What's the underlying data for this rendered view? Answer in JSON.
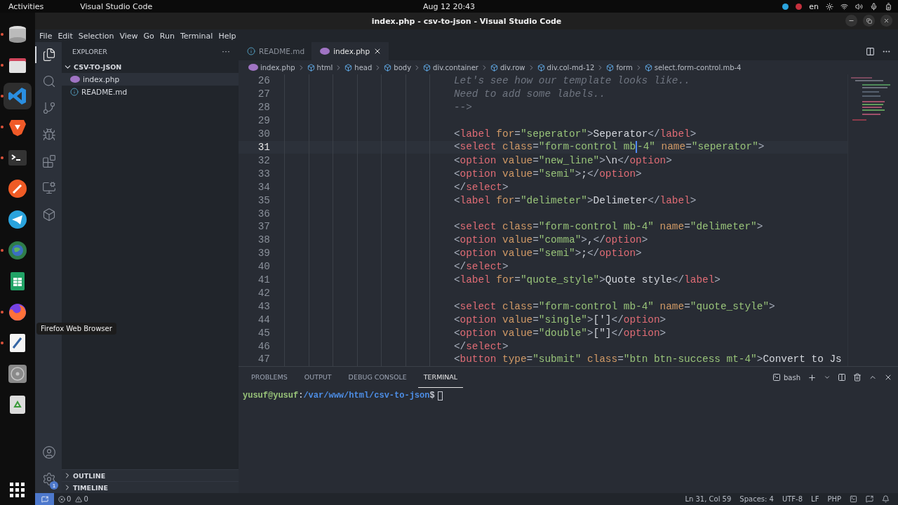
{
  "top_bar": {
    "activities": "Activities",
    "app_name": "Visual Studio Code",
    "clock": "Aug 12  20:43",
    "keyboard": "en"
  },
  "dock": {
    "items": [
      {
        "kind": "database",
        "running": true,
        "active": false
      },
      {
        "kind": "folder",
        "running": true,
        "active": false
      },
      {
        "kind": "vscode",
        "running": true,
        "active": true
      },
      {
        "kind": "brave",
        "running": true,
        "active": false
      },
      {
        "kind": "terminal",
        "running": true,
        "active": false
      },
      {
        "kind": "postman",
        "running": false,
        "active": false
      },
      {
        "kind": "telegram",
        "running": false,
        "active": false
      },
      {
        "kind": "globe",
        "running": true,
        "active": false
      },
      {
        "kind": "spreadsheet",
        "running": false,
        "active": false
      },
      {
        "kind": "firefox",
        "running": true,
        "active": false
      },
      {
        "kind": "editor",
        "running": true,
        "active": false
      },
      {
        "kind": "disc",
        "running": false,
        "active": false
      },
      {
        "kind": "trash",
        "running": false,
        "active": false
      }
    ],
    "tooltip": "Firefox Web Browser"
  },
  "window": {
    "title": "index.php - csv-to-json - Visual Studio Code"
  },
  "menu": [
    "File",
    "Edit",
    "Selection",
    "View",
    "Go",
    "Run",
    "Terminal",
    "Help"
  ],
  "activity_bar": [
    {
      "kind": "explorer",
      "selected": true
    },
    {
      "kind": "search",
      "selected": false
    },
    {
      "kind": "source-control",
      "selected": false
    },
    {
      "kind": "run",
      "selected": false
    },
    {
      "kind": "extensions",
      "selected": false
    },
    {
      "kind": "remote",
      "selected": false
    },
    {
      "kind": "docker",
      "selected": false
    }
  ],
  "settings_badge": "1",
  "sidebar": {
    "title": "EXPLORER",
    "more": "···",
    "folder": {
      "name": "CSV-TO-JSON",
      "expanded": true,
      "files": [
        {
          "name": "index.php",
          "kind": "php",
          "selected": true
        },
        {
          "name": "README.md",
          "kind": "info",
          "selected": false
        }
      ]
    },
    "sections": [
      {
        "name": "OUTLINE",
        "expanded": false
      },
      {
        "name": "TIMELINE",
        "expanded": false
      }
    ]
  },
  "tabs": [
    {
      "label": "README.md",
      "kind": "info",
      "selected": false
    },
    {
      "label": "index.php",
      "kind": "php",
      "selected": true
    }
  ],
  "breadcrumbs": [
    {
      "kind": "file",
      "text": "index.php"
    },
    {
      "kind": "symbol",
      "text": "html"
    },
    {
      "kind": "symbol",
      "text": "head"
    },
    {
      "kind": "symbol",
      "text": "body"
    },
    {
      "kind": "symbol",
      "text": "div.container"
    },
    {
      "kind": "symbol",
      "text": "div.row"
    },
    {
      "kind": "symbol",
      "text": "div.col-md-12"
    },
    {
      "kind": "symbol",
      "text": "form"
    },
    {
      "kind": "symbol",
      "text": "select.form-control.mb-4"
    }
  ],
  "code": [
    {
      "number": "26",
      "current": false,
      "tokens": [
        {
          "kind": "comment",
          "text": "Let's see how our template looks like.."
        }
      ]
    },
    {
      "number": "27",
      "current": false,
      "tokens": [
        {
          "kind": "comment",
          "text": "Need to add some labels.."
        }
      ]
    },
    {
      "number": "28",
      "current": false,
      "tokens": [
        {
          "kind": "comment",
          "text": "-->"
        }
      ]
    },
    {
      "number": "29",
      "current": false
    },
    {
      "number": "30",
      "current": false,
      "tokens": [
        {
          "kind": "punct",
          "text": "<"
        },
        {
          "kind": "tag",
          "text": "label"
        },
        {
          "kind": "attr",
          "text": " for"
        },
        {
          "kind": "punct",
          "text": "="
        },
        {
          "kind": "string",
          "text": "\"seperator\""
        },
        {
          "kind": "punct",
          "text": ">"
        },
        {
          "kind": "text",
          "text": "Seperator"
        },
        {
          "kind": "punct",
          "text": "</"
        },
        {
          "kind": "tag",
          "text": "label"
        },
        {
          "kind": "punct",
          "text": ">"
        }
      ]
    },
    {
      "number": "31",
      "current": true,
      "tokens": [
        {
          "kind": "punct",
          "text": "<"
        },
        {
          "kind": "tag",
          "text": "select"
        },
        {
          "kind": "attr",
          "text": " class"
        },
        {
          "kind": "punct",
          "text": "="
        },
        {
          "kind": "string",
          "text": "\"form-control mb",
          "cursor": true
        },
        {
          "kind": "string",
          "text": "-4\""
        },
        {
          "kind": "attr",
          "text": " name"
        },
        {
          "kind": "punct",
          "text": "="
        },
        {
          "kind": "string",
          "text": "\"seperator\""
        },
        {
          "kind": "punct",
          "text": ">"
        }
      ]
    },
    {
      "number": "32",
      "current": false,
      "tokens": [
        {
          "kind": "punct",
          "text": "<"
        },
        {
          "kind": "tag",
          "text": "option"
        },
        {
          "kind": "attr",
          "text": " value"
        },
        {
          "kind": "punct",
          "text": "="
        },
        {
          "kind": "string",
          "text": "\"new_line\""
        },
        {
          "kind": "punct",
          "text": ">"
        },
        {
          "kind": "text",
          "text": "\\n"
        },
        {
          "kind": "punct",
          "text": "</"
        },
        {
          "kind": "tag",
          "text": "option"
        },
        {
          "kind": "punct",
          "text": ">"
        }
      ]
    },
    {
      "number": "33",
      "current": false,
      "tokens": [
        {
          "kind": "punct",
          "text": "<"
        },
        {
          "kind": "tag",
          "text": "option"
        },
        {
          "kind": "attr",
          "text": " value"
        },
        {
          "kind": "punct",
          "text": "="
        },
        {
          "kind": "string",
          "text": "\"semi\""
        },
        {
          "kind": "punct",
          "text": ">"
        },
        {
          "kind": "text",
          "text": ";"
        },
        {
          "kind": "punct",
          "text": "</"
        },
        {
          "kind": "tag",
          "text": "option"
        },
        {
          "kind": "punct",
          "text": ">"
        }
      ]
    },
    {
      "number": "34",
      "current": false,
      "tokens": [
        {
          "kind": "punct",
          "text": "</"
        },
        {
          "kind": "tag",
          "text": "select"
        },
        {
          "kind": "punct",
          "text": ">"
        }
      ]
    },
    {
      "number": "35",
      "current": false,
      "tokens": [
        {
          "kind": "punct",
          "text": "<"
        },
        {
          "kind": "tag",
          "text": "label"
        },
        {
          "kind": "attr",
          "text": " for"
        },
        {
          "kind": "punct",
          "text": "="
        },
        {
          "kind": "string",
          "text": "\"delimeter\""
        },
        {
          "kind": "punct",
          "text": ">"
        },
        {
          "kind": "text",
          "text": "Delimeter"
        },
        {
          "kind": "punct",
          "text": "</"
        },
        {
          "kind": "tag",
          "text": "label"
        },
        {
          "kind": "punct",
          "text": ">"
        }
      ]
    },
    {
      "number": "36",
      "current": false
    },
    {
      "number": "37",
      "current": false,
      "tokens": [
        {
          "kind": "punct",
          "text": "<"
        },
        {
          "kind": "tag",
          "text": "select"
        },
        {
          "kind": "attr",
          "text": " class"
        },
        {
          "kind": "punct",
          "text": "="
        },
        {
          "kind": "string",
          "text": "\"form-control mb-4\""
        },
        {
          "kind": "attr",
          "text": " name"
        },
        {
          "kind": "punct",
          "text": "="
        },
        {
          "kind": "string",
          "text": "\"delimeter\""
        },
        {
          "kind": "punct",
          "text": ">"
        }
      ]
    },
    {
      "number": "38",
      "current": false,
      "tokens": [
        {
          "kind": "punct",
          "text": "<"
        },
        {
          "kind": "tag",
          "text": "option"
        },
        {
          "kind": "attr",
          "text": " value"
        },
        {
          "kind": "punct",
          "text": "="
        },
        {
          "kind": "string",
          "text": "\"comma\""
        },
        {
          "kind": "punct",
          "text": ">"
        },
        {
          "kind": "text",
          "text": ","
        },
        {
          "kind": "punct",
          "text": "</"
        },
        {
          "kind": "tag",
          "text": "option"
        },
        {
          "kind": "punct",
          "text": ">"
        }
      ]
    },
    {
      "number": "39",
      "current": false,
      "tokens": [
        {
          "kind": "punct",
          "text": "<"
        },
        {
          "kind": "tag",
          "text": "option"
        },
        {
          "kind": "attr",
          "text": " value"
        },
        {
          "kind": "punct",
          "text": "="
        },
        {
          "kind": "string",
          "text": "\"semi\""
        },
        {
          "kind": "punct",
          "text": ">"
        },
        {
          "kind": "text",
          "text": ";"
        },
        {
          "kind": "punct",
          "text": "</"
        },
        {
          "kind": "tag",
          "text": "option"
        },
        {
          "kind": "punct",
          "text": ">"
        }
      ]
    },
    {
      "number": "40",
      "current": false,
      "tokens": [
        {
          "kind": "punct",
          "text": "</"
        },
        {
          "kind": "tag",
          "text": "select"
        },
        {
          "kind": "punct",
          "text": ">"
        }
      ]
    },
    {
      "number": "41",
      "current": false,
      "tokens": [
        {
          "kind": "punct",
          "text": "<"
        },
        {
          "kind": "tag",
          "text": "label"
        },
        {
          "kind": "attr",
          "text": " for"
        },
        {
          "kind": "punct",
          "text": "="
        },
        {
          "kind": "string",
          "text": "\"quote_style\""
        },
        {
          "kind": "punct",
          "text": ">"
        },
        {
          "kind": "text",
          "text": "Quote style"
        },
        {
          "kind": "punct",
          "text": "</"
        },
        {
          "kind": "tag",
          "text": "label"
        },
        {
          "kind": "punct",
          "text": ">"
        }
      ]
    },
    {
      "number": "42",
      "current": false
    },
    {
      "number": "43",
      "current": false,
      "tokens": [
        {
          "kind": "punct",
          "text": "<"
        },
        {
          "kind": "tag",
          "text": "select"
        },
        {
          "kind": "attr",
          "text": " class"
        },
        {
          "kind": "punct",
          "text": "="
        },
        {
          "kind": "string",
          "text": "\"form-control mb-4\""
        },
        {
          "kind": "attr",
          "text": " name"
        },
        {
          "kind": "punct",
          "text": "="
        },
        {
          "kind": "string",
          "text": "\"quote_style\""
        },
        {
          "kind": "punct",
          "text": ">"
        }
      ]
    },
    {
      "number": "44",
      "current": false,
      "tokens": [
        {
          "kind": "punct",
          "text": "<"
        },
        {
          "kind": "tag",
          "text": "option"
        },
        {
          "kind": "attr",
          "text": " value"
        },
        {
          "kind": "punct",
          "text": "="
        },
        {
          "kind": "string",
          "text": "\"single\""
        },
        {
          "kind": "punct",
          "text": ">"
        },
        {
          "kind": "text",
          "text": "[']"
        },
        {
          "kind": "punct",
          "text": "</"
        },
        {
          "kind": "tag",
          "text": "option"
        },
        {
          "kind": "punct",
          "text": ">"
        }
      ]
    },
    {
      "number": "45",
      "current": false,
      "tokens": [
        {
          "kind": "punct",
          "text": "<"
        },
        {
          "kind": "tag",
          "text": "option"
        },
        {
          "kind": "attr",
          "text": " value"
        },
        {
          "kind": "punct",
          "text": "="
        },
        {
          "kind": "string",
          "text": "\"double\""
        },
        {
          "kind": "punct",
          "text": ">"
        },
        {
          "kind": "text",
          "text": "[\"]"
        },
        {
          "kind": "punct",
          "text": "</"
        },
        {
          "kind": "tag",
          "text": "option"
        },
        {
          "kind": "punct",
          "text": ">"
        }
      ]
    },
    {
      "number": "46",
      "current": false,
      "tokens": [
        {
          "kind": "punct",
          "text": "</"
        },
        {
          "kind": "tag",
          "text": "select"
        },
        {
          "kind": "punct",
          "text": ">"
        }
      ]
    },
    {
      "number": "47",
      "current": false,
      "tokens": [
        {
          "kind": "punct",
          "text": "<"
        },
        {
          "kind": "tag",
          "text": "button"
        },
        {
          "kind": "attr",
          "text": " type"
        },
        {
          "kind": "punct",
          "text": "="
        },
        {
          "kind": "string",
          "text": "\"submit\""
        },
        {
          "kind": "attr",
          "text": " class"
        },
        {
          "kind": "punct",
          "text": "="
        },
        {
          "kind": "string",
          "text": "\"btn btn-success mt-4\""
        },
        {
          "kind": "punct",
          "text": ">"
        },
        {
          "kind": "text",
          "text": "Convert to Js"
        }
      ]
    }
  ],
  "panel": {
    "tabs": [
      {
        "label": "PROBLEMS",
        "selected": false
      },
      {
        "label": "OUTPUT",
        "selected": false
      },
      {
        "label": "DEBUG CONSOLE",
        "selected": false
      },
      {
        "label": "TERMINAL",
        "selected": true
      }
    ],
    "shell": "bash",
    "prompt": {
      "user": "yusuf@yusuf",
      "separator": ":",
      "path": "/var/www/html/csv-to-json",
      "symbol": "$"
    }
  },
  "status_bar": {
    "errors": "0",
    "warnings": "0",
    "items": [
      "Ln 31, Col 59",
      "Spaces: 4",
      "UTF-8",
      "LF",
      "PHP"
    ]
  }
}
